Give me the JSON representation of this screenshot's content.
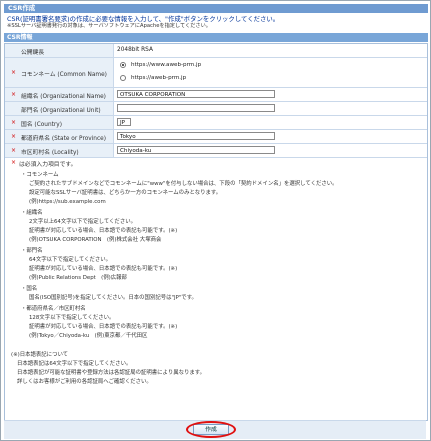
{
  "header": {
    "title": "CSR作成"
  },
  "intro": {
    "line1": "CSR(証明書署名要求)の作成に必要な情報を入力して、\"作成\"ボタンをクリックしてください。",
    "line2": "※SSLサーバ証明書発行の対象は、サーバソフトウェアにApacheを指定してください。"
  },
  "section": {
    "title": "CSR情報"
  },
  "form": {
    "key_length": {
      "label": "公開鍵長",
      "value": "2048bit RSA"
    },
    "common_name": {
      "label": "コモンネーム (Common Name)",
      "options": [
        "https://www.aweb-prm.jp",
        "https://aweb-prm.jp"
      ],
      "selected_index": 0
    },
    "org_name": {
      "label": "組織名 (Organizational Name)",
      "value": "OTSUKA CORPORATION"
    },
    "org_unit": {
      "label": "部門名 (Organizational Unit)",
      "value": ""
    },
    "country": {
      "label": "国名 (Country)",
      "value": "JP"
    },
    "state": {
      "label": "都道府県名 (State or Province)",
      "value": "Tokyo"
    },
    "locality": {
      "label": "市区町村名 (Locality)",
      "value": "Chiyoda-ku"
    },
    "required_marker": "×"
  },
  "notes": {
    "head": "は必須入力項目です。",
    "lines": [
      "・コモンネーム",
      "ご契約されたサブドメインなどでコモンネームに\"www\"を付与しない場合は、下段の「契約ドメイン名」を選択してください。",
      "設定可能なSSLサーバ証明書は、どちらか一方のコモンネームのみとなります。",
      "(例)https://sub.example.com",
      "・組織名",
      "2文字以上64文字以下で指定してください。",
      "証明書が対応している場合、日本語での表記も可能です。(※)",
      "(例)OTSUKA CORPORATION　(例)株式会社 大塚商会",
      "・部門名",
      "64文字以下で指定してください。",
      "証明書が対応している場合、日本語での表記も可能です。(※)",
      "(例)Public Relations Dept　(例)広報部",
      "・国名",
      "国名(ISO国別記号)を指定してください。日本の国別記号は\"JP\"です。",
      "・都道府県名／市区町村名",
      "128文字以下で指定してください。",
      "証明書が対応している場合、日本語での表記も可能です。(※)",
      "(例)Tokyo／Chiyoda-ku　(例)東京都／千代田区",
      "(※)日本語表記について",
      "日本語表記は64文字以下で指定してください。",
      "日本語表記が可能な証明書や登録方法は各認証局の証明書により異なります。",
      "詳しくはお客様がご利用の各認証局へご確認ください。"
    ]
  },
  "footer": {
    "submit_label": "作成"
  }
}
